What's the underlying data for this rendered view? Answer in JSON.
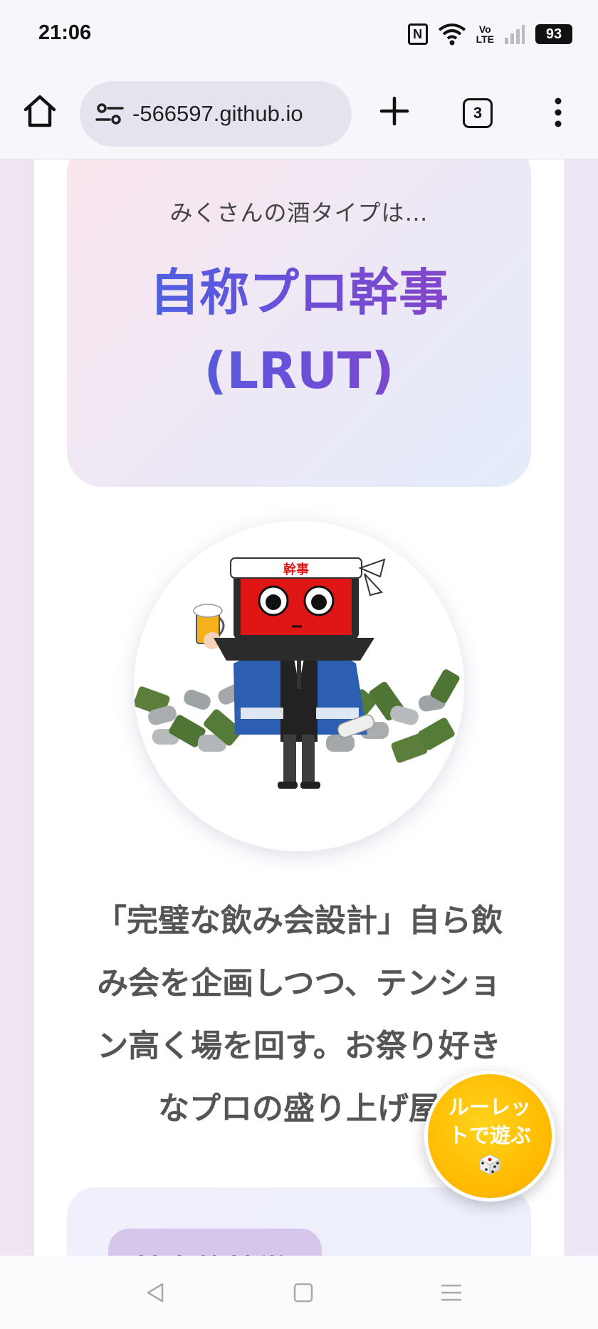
{
  "status_bar": {
    "time": "21:06",
    "icons": [
      "nfc-icon",
      "wifi-icon",
      "volte-icon",
      "signal-icon"
    ],
    "volte_top": "Vo",
    "volte_bottom": "LTE",
    "battery": "93"
  },
  "browser": {
    "url": "-566597.github.io",
    "tab_count": "3",
    "icons": [
      "home-icon",
      "site-settings-icon",
      "plus-icon",
      "tabs-icon",
      "more-vert-icon"
    ]
  },
  "result": {
    "intro": "みくさんの酒タイプは…",
    "type_name_line1": "自称プロ幹事",
    "type_name_line2": "(LRUT)",
    "headband_text": "幹事",
    "description_line1": "「完璧な飲み会設計」自ら飲",
    "description_line2": "み会を企画しつつ、テンショ",
    "description_line3": "ン高く場を回す。お祭り好き",
    "description_line4": "なプロの盛り上げ屋"
  },
  "features": {
    "chip_label": "基本的特徴"
  },
  "roulette": {
    "line1": "ルーレッ",
    "line2": "トで遊ぶ",
    "icon": "dice-icon"
  },
  "nav": {
    "icons": [
      "back-icon",
      "home-square-icon",
      "recents-icon"
    ]
  },
  "colors": {
    "title_gradient_start": "#3c6ae6",
    "title_gradient_end": "#9140c2",
    "roulette": "#ffba00",
    "laptop_red": "#e01616",
    "happi_blue": "#2c5fb2"
  }
}
